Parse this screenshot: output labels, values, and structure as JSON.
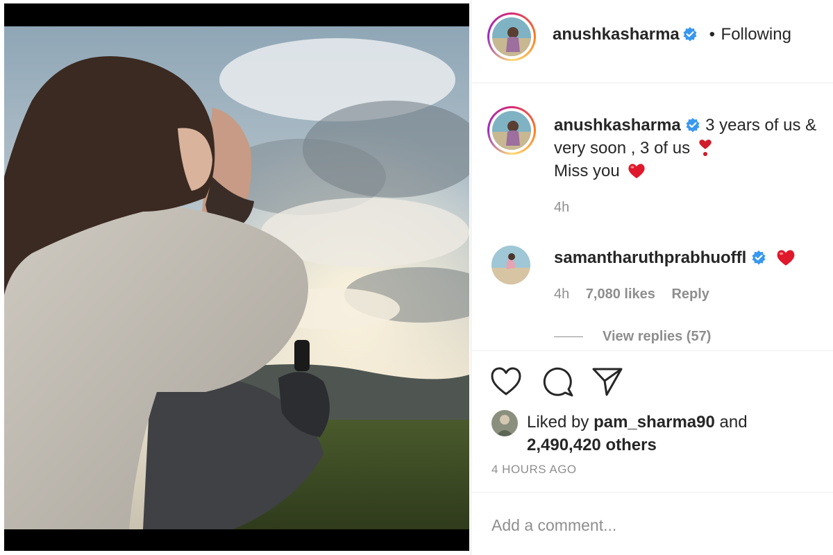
{
  "post_header": {
    "username": "anushkasharma",
    "separator": "•",
    "follow_status": "Following"
  },
  "caption": {
    "username": "anushkasharma",
    "line1": "3 years of us &",
    "line2": "very soon , 3 of us",
    "line3": "Miss you",
    "time": "4h"
  },
  "comments": [
    {
      "username": "samantharuthprabhuoffl",
      "text_icon": "red-heart-icon",
      "time": "4h",
      "likes": "7,080 likes",
      "reply_label": "Reply",
      "view_replies": "View replies (57)"
    }
  ],
  "actions": {
    "icons": [
      "heart-icon",
      "comment-icon",
      "share-icon"
    ]
  },
  "likes": {
    "prefix": "Liked by",
    "user": "pam_sharma90",
    "conjunction": "and",
    "others": "2,490,420 others"
  },
  "timestamp": "4 HOURS AGO",
  "comment_box": {
    "placeholder": "Add a comment..."
  },
  "colors": {
    "verified": "#3897f0",
    "heart": "#ed4956",
    "muted_text": "#8e8e8e",
    "primary_text": "#262626"
  }
}
